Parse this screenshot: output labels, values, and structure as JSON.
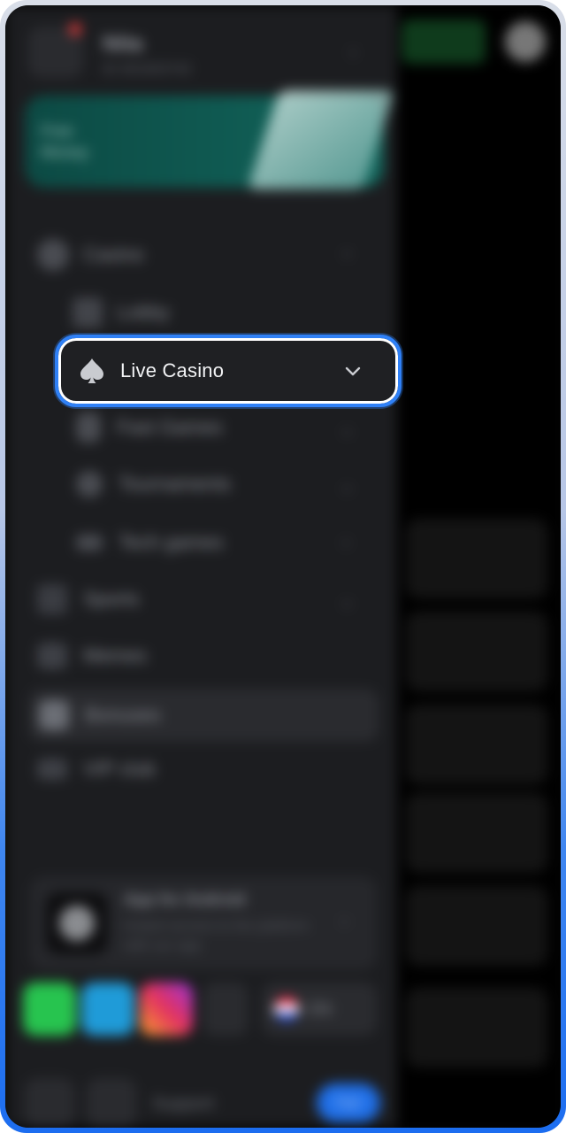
{
  "highlight": {
    "label": "Live Casino"
  },
  "drawer": {
    "profile": {
      "name": "Nita",
      "subtitle": "ID 001003742"
    },
    "promo": {
      "title": "Free Money"
    },
    "menu": [
      {
        "label": "Casino"
      },
      {
        "label": "Lobby"
      },
      {
        "label": "Fast Games"
      },
      {
        "label": "Tournaments"
      },
      {
        "label": "Tech games"
      },
      {
        "label": "Sports"
      },
      {
        "label": "Memes"
      },
      {
        "label": "Bonuses"
      },
      {
        "label": "VIP club"
      }
    ],
    "app_card": {
      "title": "App for Android",
      "text": "Instant access to the platform with our app"
    },
    "language": "EN",
    "footer": {
      "support": "Support",
      "button": "Sign"
    }
  },
  "colors": {
    "accent": "#2f80f6",
    "drawer_bg": "#1c1d20",
    "ring": "#ffffff"
  }
}
